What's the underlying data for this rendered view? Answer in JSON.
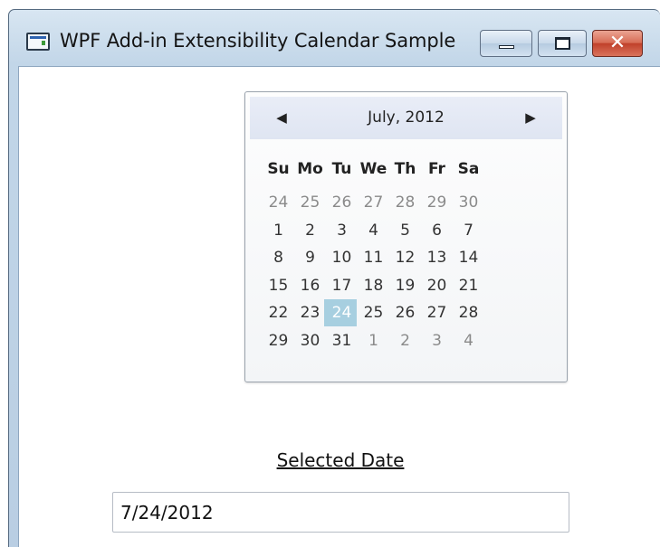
{
  "window": {
    "title": "WPF Add-in Extensibility Calendar Sample",
    "controls": {
      "minimize_icon": "minimize-icon",
      "maximize_icon": "maximize-icon",
      "close_glyph": "✕"
    }
  },
  "calendar": {
    "month_label": "July, 2012",
    "prev_icon": "◀",
    "next_icon": "▶",
    "weekdays": [
      "Su",
      "Mo",
      "Tu",
      "We",
      "Th",
      "Fr",
      "Sa"
    ],
    "weeks": [
      [
        "24",
        "25",
        "26",
        "27",
        "28",
        "29",
        "30"
      ],
      [
        "1",
        "2",
        "3",
        "4",
        "5",
        "6",
        "7"
      ],
      [
        "8",
        "9",
        "10",
        "11",
        "12",
        "13",
        "14"
      ],
      [
        "15",
        "16",
        "17",
        "18",
        "19",
        "20",
        "21"
      ],
      [
        "22",
        "23",
        "24",
        "25",
        "26",
        "27",
        "28"
      ],
      [
        "29",
        "30",
        "31",
        "1",
        "2",
        "3",
        "4"
      ]
    ],
    "selected_day": "24"
  },
  "selected_date": {
    "label": "Selected Date",
    "value": "7/24/2012"
  },
  "colors": {
    "selection": "#a7cfe0",
    "header": "#e3e8f4"
  }
}
